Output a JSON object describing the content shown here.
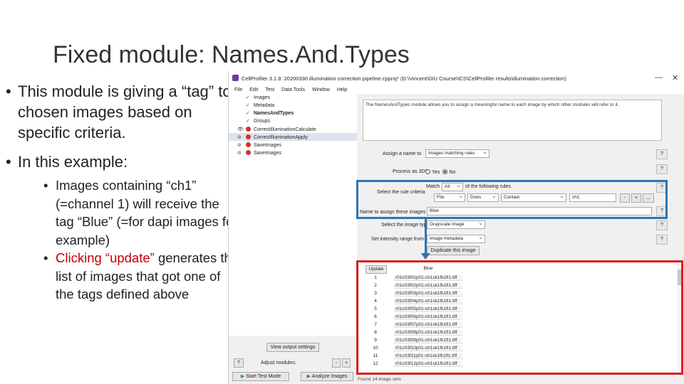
{
  "slide": {
    "title": "Fixed module: Names.And.Types",
    "bullet1": "This module is giving a “tag” to chosen images based on specific criteria.",
    "bullet2": "In this example:",
    "sub1": "Images containing “ch1” (=channel 1) will receive the tag “Blue” (=for dapi images for example)",
    "sub2_highlight": "Clicking “update”",
    "sub2_rest": " generates the list of images that got one of the tags defined above"
  },
  "window": {
    "title": "CellProfiler 3.1.8: 20200330 illumination correction pipeline.cpproj* (D:\\Vincent\\DIU Course\\ICS\\CellProfiler results\\illumination correction)",
    "minimize": "—",
    "close": "✕"
  },
  "menu": [
    "File",
    "Edit",
    "Test",
    "Data Tools",
    "Window",
    "Help"
  ],
  "pipeline": {
    "modules": [
      "Images",
      "Metadata",
      "NamesAndTypes",
      "Groups",
      "CorrectIlluminationCalculate",
      "CorrectIlluminationApply",
      "SaveImages",
      "SaveImages"
    ],
    "selected_index": 2
  },
  "settings": {
    "description": "The NamesAndTypes module allows you to assign a meaningful name to each image by which other modules will refer to it.",
    "assign_label": "Assign a name to",
    "assign_value": "Images matching rules",
    "process3d_label": "Process as 3D?",
    "yes_label": "Yes",
    "no_label": "No",
    "rules_label": "Select the rule criteria",
    "match_label": "Match",
    "match_value": "All",
    "match_suffix": "of the following rules",
    "rule_field": "File",
    "rule_op": "Does",
    "rule_cmp": "Contain",
    "rule_value": "ch1",
    "name_label": "Name to assign these images",
    "name_value": "Blue",
    "type_label": "Select the image type",
    "type_value": "Grayscale image",
    "intensity_label": "Set intensity range from",
    "intensity_value": "Image metadata",
    "duplicate_btn": "Duplicate this image",
    "help": "?",
    "minus": "-",
    "plus": "+",
    "more": "..."
  },
  "table": {
    "update_btn": "Update",
    "column": "Blue",
    "rows": [
      {
        "n": "1",
        "file": "r01c03f01p01-ch1sk1fk1fl1.tiff"
      },
      {
        "n": "2",
        "file": "r01c03f02p01-ch1sk1fk1fl1.tiff"
      },
      {
        "n": "3",
        "file": "r01c03f03p01-ch1sk1fk1fl1.tiff"
      },
      {
        "n": "4",
        "file": "r01c03f04p01-ch1sk1fk1fl1.tiff"
      },
      {
        "n": "5",
        "file": "r01c03f05p01-ch1sk1fk1fl1.tiff"
      },
      {
        "n": "6",
        "file": "r01c03f06p01-ch1sk1fk1fl1.tiff"
      },
      {
        "n": "7",
        "file": "r01c03f07p01-ch1sk1fk1fl1.tiff"
      },
      {
        "n": "8",
        "file": "r01c03f08p01-ch1sk1fk1fl1.tiff"
      },
      {
        "n": "9",
        "file": "r01c03f09p01-ch1sk1fk1fl1.tiff"
      },
      {
        "n": "10",
        "file": "r01c03f10p01-ch1sk1fk1fl1.tiff"
      },
      {
        "n": "11",
        "file": "r01c03f11p01-ch1sk1fk1fl1.tiff"
      },
      {
        "n": "12",
        "file": "r01c03f12p01-ch1sk1fk1fl1.tiff"
      }
    ]
  },
  "bottom": {
    "view_output": "View output settings",
    "help": "?",
    "adjust_modules": "Adjust modules:",
    "minus": "-",
    "plus": "+",
    "start_test": "Start Test Mode",
    "analyze": "Analyze Images",
    "status": "Found 14 image sets"
  },
  "colors": {
    "highlight_blue": "#2e75b6",
    "highlight_red": "#e02020",
    "text_red": "#c00000"
  }
}
